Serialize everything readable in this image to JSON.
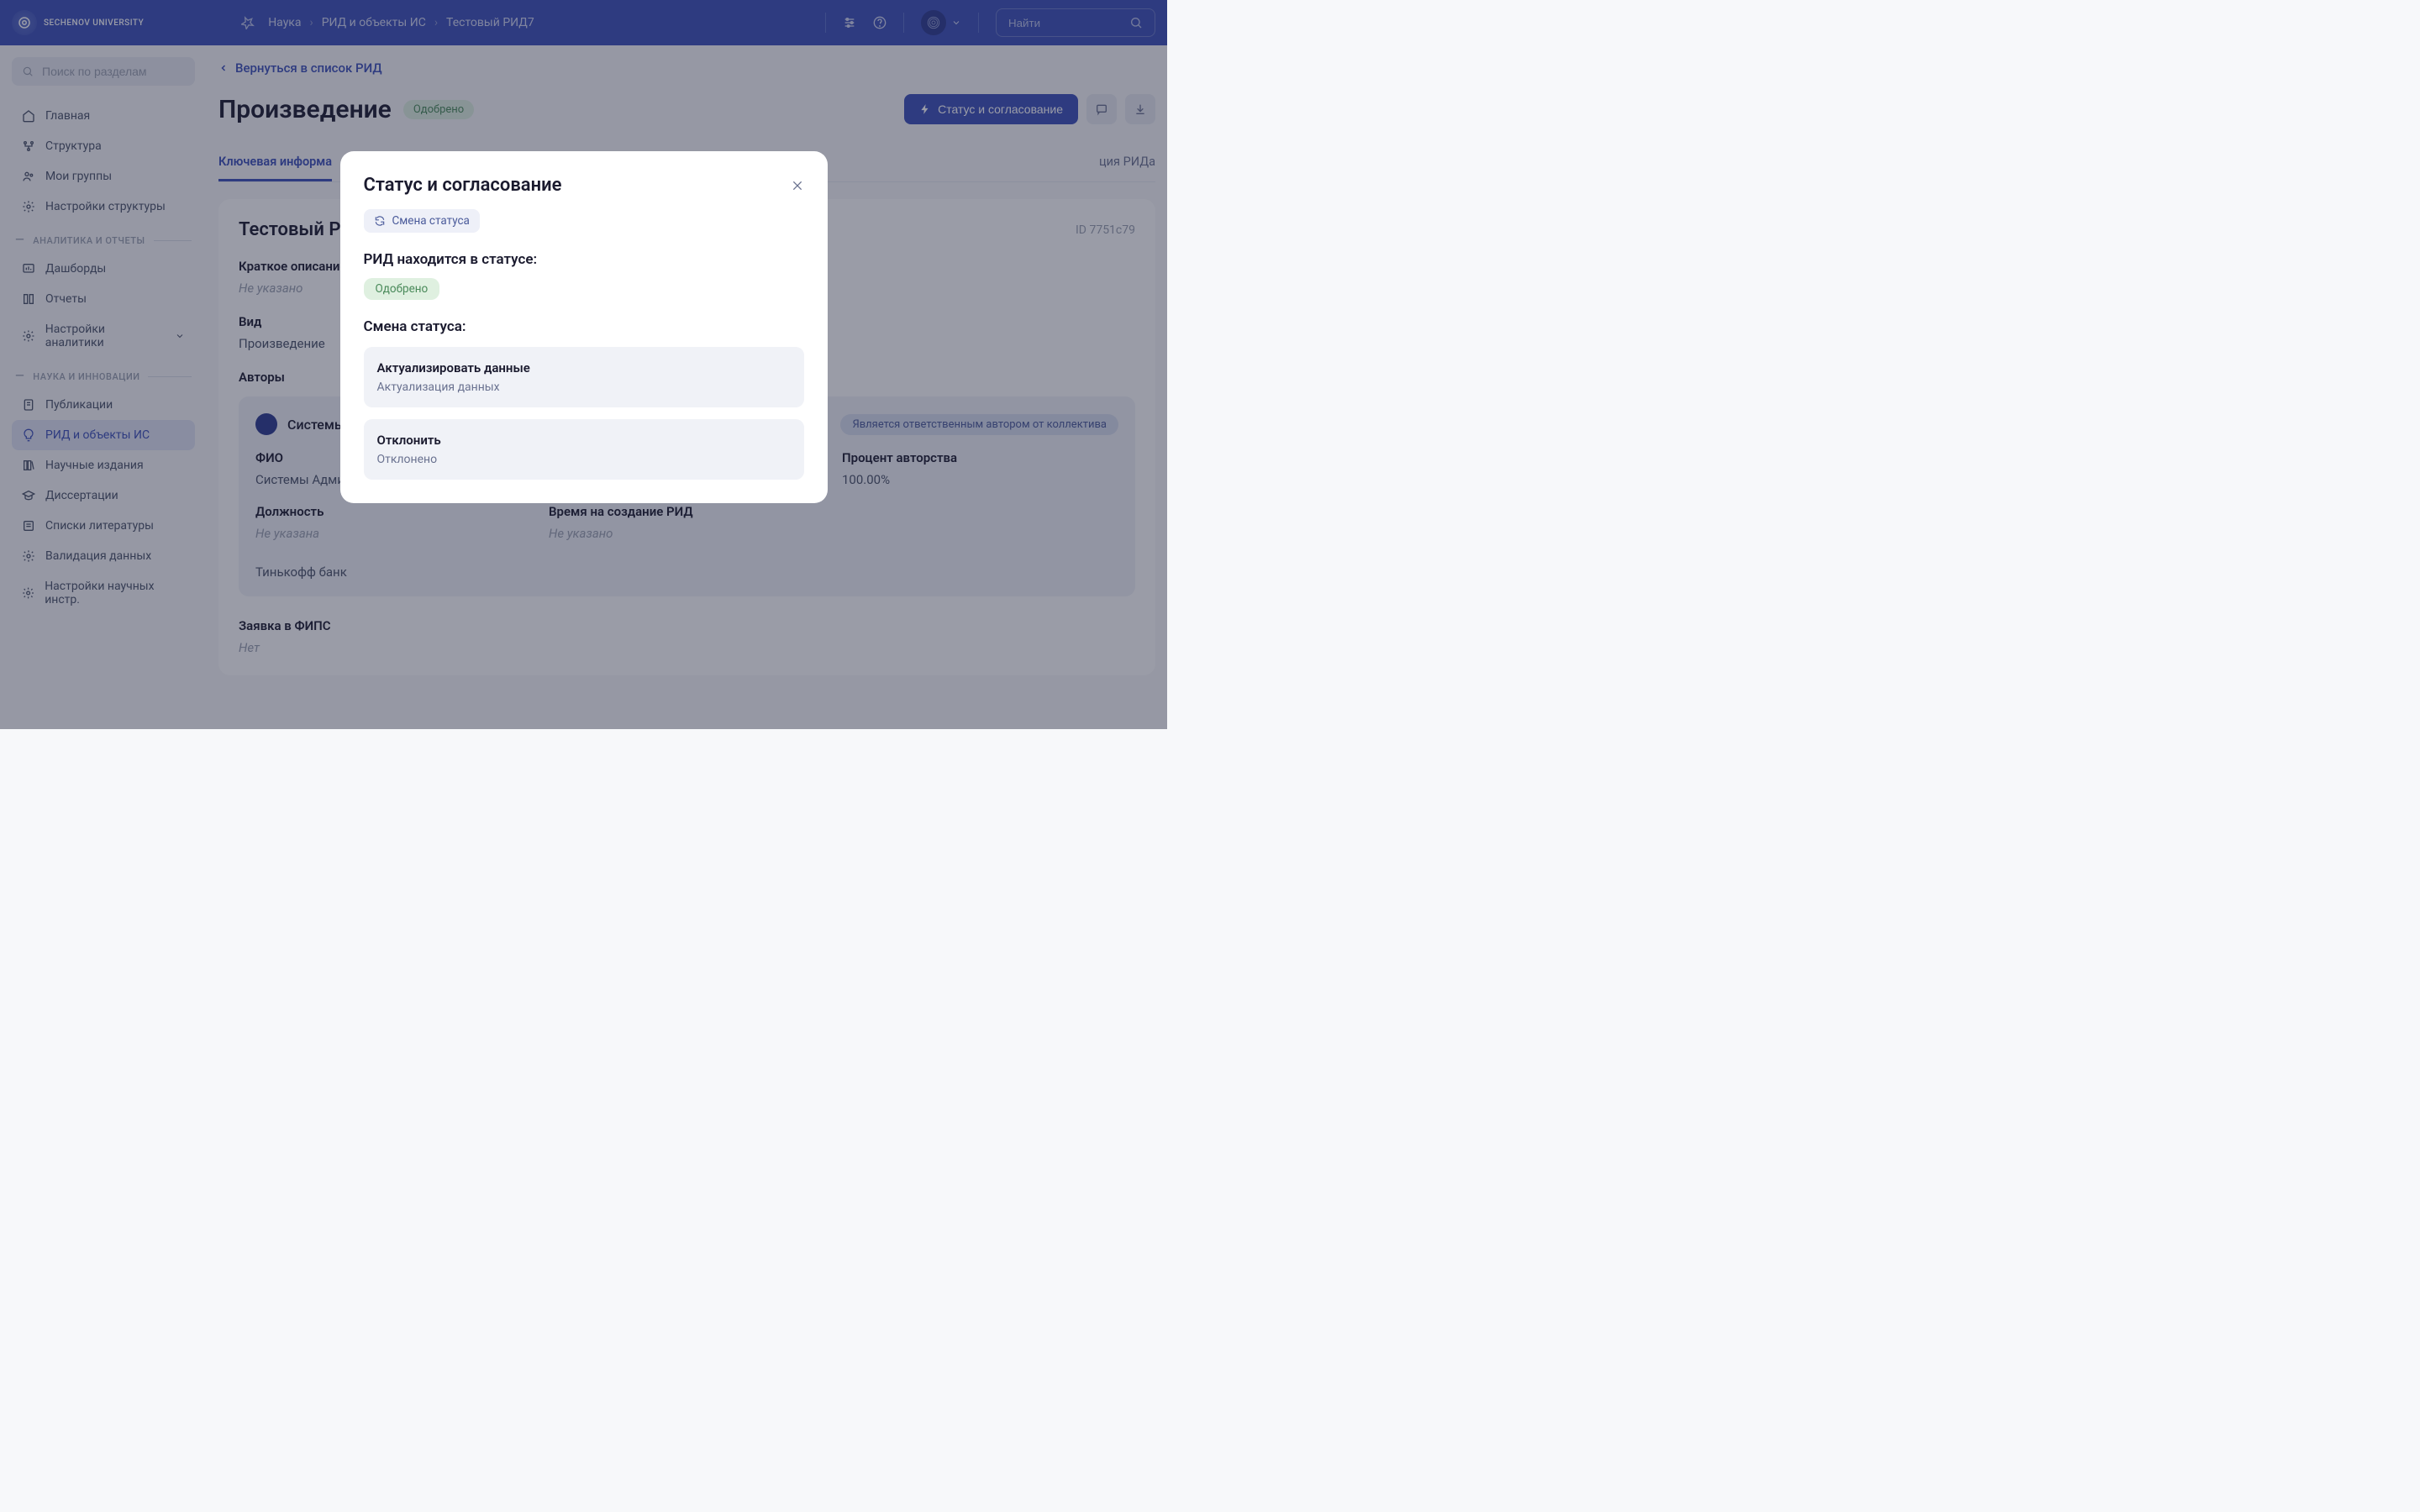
{
  "header": {
    "logo_text": "SECHENOV\nUNIVERSITY",
    "breadcrumb": [
      "Наука",
      "РИД и объекты ИС",
      "Тестовый РИД7"
    ],
    "search_placeholder": "Найти"
  },
  "sidebar": {
    "search_placeholder": "Поиск по разделам",
    "items_top": [
      {
        "label": "Главная"
      },
      {
        "label": "Структура"
      },
      {
        "label": "Мои группы"
      },
      {
        "label": "Настройки структуры"
      }
    ],
    "section1": "АНАЛИТИКА И ОТЧЕТЫ",
    "items_analytics": [
      {
        "label": "Дашборды"
      },
      {
        "label": "Отчеты"
      },
      {
        "label": "Настройки аналитики"
      }
    ],
    "section2": "НАУКА И ИННОВАЦИИ",
    "items_science": [
      {
        "label": "Публикации"
      },
      {
        "label": "РИД и объекты ИС"
      },
      {
        "label": "Научные издания"
      },
      {
        "label": "Диссертации"
      },
      {
        "label": "Списки литературы"
      },
      {
        "label": "Валидация данных"
      },
      {
        "label": "Настройки научных инстр."
      }
    ]
  },
  "main": {
    "back_link": "Вернуться в список РИД",
    "title": "Произведение",
    "badge": "Одобрено",
    "status_button": "Статус и согласование",
    "tabs": [
      {
        "label": "Ключевая информа",
        "active": true
      },
      {
        "label": "ция РИДа",
        "active": false
      }
    ],
    "card": {
      "title": "Тестовый РИ",
      "id_label": "ID 7751c79",
      "short_desc_label": "Краткое описание",
      "short_desc_value": "Не указано",
      "kind_label": "Вид",
      "kind_value": "Произведение",
      "authors_label": "Авторы",
      "author": {
        "name": "Системы",
        "badge": "Является ответственным автором от коллектива",
        "fio_label": "ФИО",
        "fio_value": "Системы Админ",
        "percent_label": "Процент авторства",
        "percent_value": "100.00%",
        "position_label": "Должность",
        "position_value": "Не указана",
        "time_label": "Время на создание РИД",
        "time_value": "Не указано",
        "bank": "Тинькофф банк"
      },
      "fips_label": "Заявка в ФИПС",
      "fips_value": "Нет"
    }
  },
  "modal": {
    "title": "Статус и согласование",
    "change_chip": "Смена статуса",
    "status_label": "РИД находится в статусе:",
    "status_value": "Одобрено",
    "change_label": "Смена статуса:",
    "options": [
      {
        "title": "Актуализировать данные",
        "sub": "Актуализация данных"
      },
      {
        "title": "Отклонить",
        "sub": "Отклонено"
      }
    ]
  }
}
